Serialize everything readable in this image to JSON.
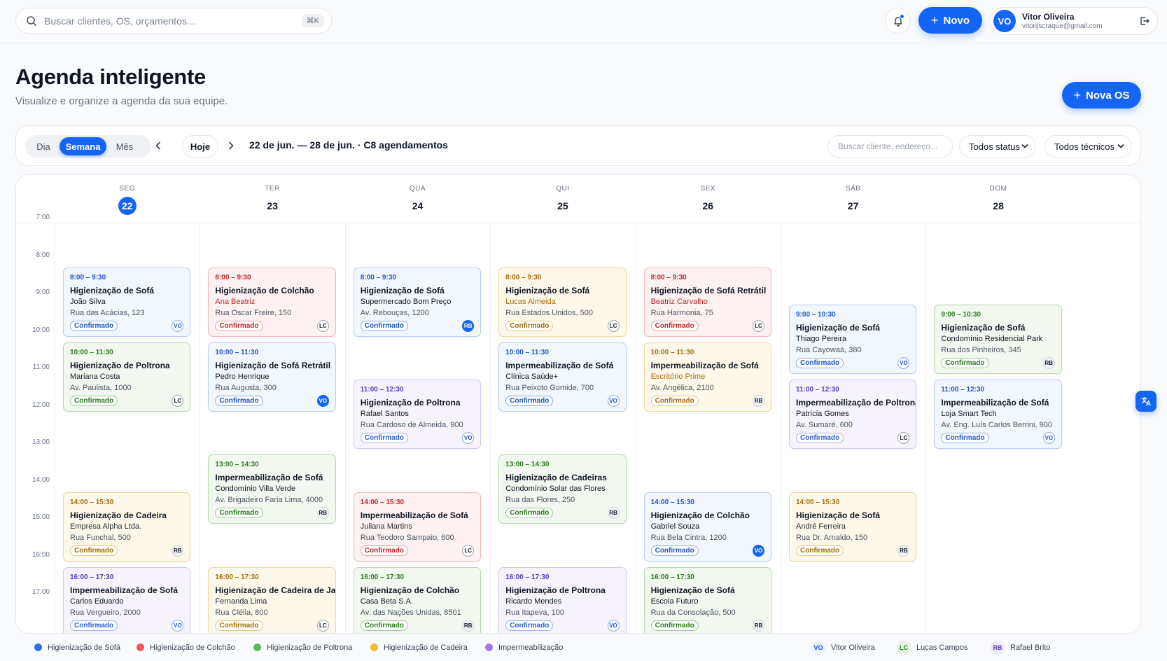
{
  "search": {
    "placeholder": "Buscar clientes, OS, orçamentos...",
    "shortcut": "⌘K"
  },
  "topbar": {
    "new_label": "Novo"
  },
  "user": {
    "initials": "VO",
    "name": "Vitor Oliveira",
    "email": "vitorijscraque@gmail.com"
  },
  "page": {
    "title": "Agenda inteligente",
    "subtitle": "Visualize e organize a agenda da sua equipe.",
    "new_os_label": "Nova OS"
  },
  "toolbar": {
    "views": [
      "Dia",
      "Semana",
      "Mês"
    ],
    "active_view": "Semana",
    "today_label": "Hoje",
    "range_label": "22 de jun. — 28 de jun. · C8 agendamentos",
    "filter_search_placeholder": "Buscar cliente, endereço...",
    "status_filter": "Todos status",
    "tech_filter": "Todos técnicos"
  },
  "days": [
    {
      "weekday": "SEG",
      "day": "22",
      "today": true
    },
    {
      "weekday": "TER",
      "day": "23",
      "today": false
    },
    {
      "weekday": "QUA",
      "day": "24",
      "today": false
    },
    {
      "weekday": "QUI",
      "day": "25",
      "today": false
    },
    {
      "weekday": "SEX",
      "day": "26",
      "today": false
    },
    {
      "weekday": "SÁB",
      "day": "27",
      "today": false
    },
    {
      "weekday": "DOM",
      "day": "28",
      "today": false
    }
  ],
  "hours": [
    "7:00",
    "8:00",
    "9:00",
    "10:00",
    "11:00",
    "12:00",
    "13:00",
    "14:00",
    "15:00",
    "16:00",
    "17:00"
  ],
  "events": [
    {
      "day": 0,
      "type": "sofa",
      "time": "8:00 – 9:30",
      "title": "Higienização de Sofá",
      "client": "João Silva",
      "address": "Rua das Acácias, 123",
      "status": "Confirmado",
      "tech": "VO",
      "tech_filled": false
    },
    {
      "day": 0,
      "type": "poltrona",
      "time": "10:00 – 11:30",
      "title": "Higienização de Poltrona",
      "client": "Mariana Costa",
      "address": "Av. Paulista, 1000",
      "status": "Confirmado",
      "tech": "LC",
      "tech_filled": false
    },
    {
      "day": 0,
      "type": "cadeira",
      "time": "14:00 – 15:30",
      "title": "Higienização de Cadeira",
      "client": "Empresa Alpha Ltda.",
      "address": "Rua Funchal, 500",
      "status": "Confirmado",
      "tech": "RB",
      "tech_filled": false,
      "client_dark": true
    },
    {
      "day": 0,
      "type": "imper",
      "time": "16:00 – 17:30",
      "title": "Impermeabilização de Sofá",
      "client": "Carlos Eduardo",
      "address": "Rua Vergueiro, 2000",
      "status": "Confirmado",
      "tech": "VO",
      "tech_filled": false
    },
    {
      "day": 1,
      "type": "colchao",
      "time": "8:00 – 9:30",
      "title": "Higienização de Colchão",
      "client": "Ana Beatriz",
      "address": "Rua Oscar Freire, 150",
      "status": "Confirmado",
      "tech": "LC",
      "tech_filled": false
    },
    {
      "day": 1,
      "type": "sofa",
      "time": "10:00 – 11:30",
      "title": "Higienização de Sofá Retrátil",
      "client": "Pedro Henrique",
      "address": "Rua Augusta, 300",
      "status": "Confirmado",
      "tech": "VO",
      "tech_filled": true
    },
    {
      "day": 1,
      "type": "poltrona",
      "time": "13:00 – 14:30",
      "title": "Impermeabilização de Sofá",
      "client": "Condomínio Villa Verde",
      "address": "Av. Brigadeiro Faria Lima, 4000",
      "status": "Confirmado",
      "tech": "RB",
      "tech_filled": false
    },
    {
      "day": 1,
      "type": "cadeira",
      "time": "16:00 – 17:30",
      "title": "Higienização de Cadeira de Jantar",
      "client": "Fernanda Lima",
      "address": "Rua Clélia, 800",
      "status": "Confirmado",
      "tech": "LC",
      "tech_filled": false,
      "client_dark": true
    },
    {
      "day": 2,
      "type": "sofa",
      "time": "8:00 – 9:30",
      "title": "Higienização de Sofá",
      "client": "Supermercado Bom Preço",
      "address": "Av. Rebouças, 1200",
      "status": "Confirmado",
      "tech": "RB",
      "tech_filled": true
    },
    {
      "day": 2,
      "type": "imper",
      "time": "11:00 – 12:30",
      "title": "Higienização de Poltrona",
      "client": "Rafael Santos",
      "address": "Rua Cardoso de Almeida, 900",
      "status": "Confirmado",
      "tech": "VO",
      "tech_filled": false
    },
    {
      "day": 2,
      "type": "colchao",
      "time": "14:00 – 15:30",
      "title": "Impermeabilização de Sofá",
      "client": "Juliana Martins",
      "address": "Rua Teodoro Sampaio, 600",
      "status": "Confirmado",
      "tech": "LC",
      "tech_filled": false,
      "client_dark": true
    },
    {
      "day": 2,
      "type": "poltrona",
      "time": "16:00 – 17:30",
      "title": "Higienização de Colchão",
      "client": "Casa Beta S.A.",
      "address": "Av. das Nações Unidas, 8501",
      "status": "Confirmado",
      "tech": "RB",
      "tech_filled": false
    },
    {
      "day": 3,
      "type": "cadeira",
      "time": "8:00 – 9:30",
      "title": "Higienização de Sofá",
      "client": "Lucas Almeida",
      "address": "Rua Estados Unidos, 500",
      "status": "Confirmado",
      "tech": "LC",
      "tech_filled": false
    },
    {
      "day": 3,
      "type": "sofa",
      "time": "10:00 – 11:30",
      "title": "Impermeabilização de Sofá",
      "client": "Clínica Saúde+",
      "address": "Rua Peixoto Gomide, 700",
      "status": "Confirmado",
      "tech": "VO",
      "tech_filled": false
    },
    {
      "day": 3,
      "type": "poltrona",
      "time": "13:00 – 14:30",
      "title": "Higienização de Cadeiras",
      "client": "Condomínio Solar das Flores",
      "address": "Rua das Flores, 250",
      "status": "Confirmado",
      "tech": "RB",
      "tech_filled": false
    },
    {
      "day": 3,
      "type": "imper",
      "time": "16:00 – 17:30",
      "title": "Higienização de Poltrona",
      "client": "Ricardo Mendes",
      "address": "Rua Itapeva, 100",
      "status": "Confirmado",
      "tech": "VO",
      "tech_filled": false
    },
    {
      "day": 4,
      "type": "colchao",
      "time": "8:00 – 9:30",
      "title": "Higienização de Sofá Retrátil",
      "client": "Beatriz Carvalho",
      "address": "Rua Harmonia, 75",
      "status": "Confirmado",
      "tech": "LC",
      "tech_filled": false
    },
    {
      "day": 4,
      "type": "cadeira",
      "time": "10:00 – 11:30",
      "title": "Impermeabilização de Sofá",
      "client": "Escritório Prime",
      "address": "Av. Angélica, 2100",
      "status": "Confirmado",
      "tech": "RB",
      "tech_filled": false
    },
    {
      "day": 4,
      "type": "sofa",
      "time": "14:00 – 15:30",
      "title": "Higienização de Colchão",
      "client": "Gabriel Souza",
      "address": "Rua Bela Cintra, 1200",
      "status": "Confirmado",
      "tech": "VO",
      "tech_filled": true
    },
    {
      "day": 4,
      "type": "poltrona",
      "time": "16:00 – 17:30",
      "title": "Higienização de Sofá",
      "client": "Escola Futuro",
      "address": "Rua da Consolação, 500",
      "status": "Confirmado",
      "tech": "RB",
      "tech_filled": false
    },
    {
      "day": 5,
      "type": "sofa",
      "time": "9:00 – 10:30",
      "title": "Higienização de Sofá",
      "client": "Thiago Pereira",
      "address": "Rua Cayowaá, 380",
      "status": "Confirmado",
      "tech": "VO",
      "tech_filled": false
    },
    {
      "day": 5,
      "type": "imper",
      "time": "11:00 – 12:30",
      "title": "Impermeabilização de Poltrona",
      "client": "Patrícia Gomes",
      "address": "Av. Sumaré, 600",
      "status": "Confirmado",
      "tech": "LC",
      "tech_filled": false
    },
    {
      "day": 5,
      "type": "cadeira",
      "time": "14:00 – 15:30",
      "title": "Higienização de Sofá",
      "client": "André Ferreira",
      "address": "Rua Dr. Arnaldo, 150",
      "status": "Confirmado",
      "tech": "RB",
      "tech_filled": false,
      "client_dark": true
    },
    {
      "day": 6,
      "type": "poltrona",
      "time": "9:00 – 10:30",
      "title": "Higienização de Sofá",
      "client": "Condomínio Residencial Park",
      "address": "Rua dos Pinheiros, 345",
      "status": "Confirmado",
      "tech": "RB",
      "tech_filled": false
    },
    {
      "day": 6,
      "type": "sofa",
      "time": "11:00 – 12:30",
      "title": "Impermeabilização de Sofá",
      "client": "Loja Smart Tech",
      "address": "Av. Eng. Luís Carlos Berrini, 900",
      "status": "Confirmado",
      "tech": "VO",
      "tech_filled": false
    }
  ],
  "legend": {
    "services": [
      {
        "label": "Higienização de Sofá",
        "color": "#2f6fe6"
      },
      {
        "label": "Higienização de Colchão",
        "color": "#ef5b5b"
      },
      {
        "label": "Higienização de Poltrona",
        "color": "#5cb85c"
      },
      {
        "label": "Higienização de Cadeira",
        "color": "#f5b82e"
      },
      {
        "label": "Impermeabilização",
        "color": "#a47ae8"
      }
    ],
    "techs": [
      {
        "initials": "VO",
        "name": "Vitor Oliveira",
        "bg": "#e8effd",
        "fg": "#1e56c8"
      },
      {
        "initials": "LC",
        "name": "Lucas Campos",
        "bg": "#e6f4e3",
        "fg": "#2d7a1f"
      },
      {
        "initials": "RB",
        "name": "Rafael Brito",
        "bg": "#efe9fb",
        "fg": "#5b3bb5"
      }
    ]
  },
  "colors": {
    "accent": "#1565f5"
  }
}
